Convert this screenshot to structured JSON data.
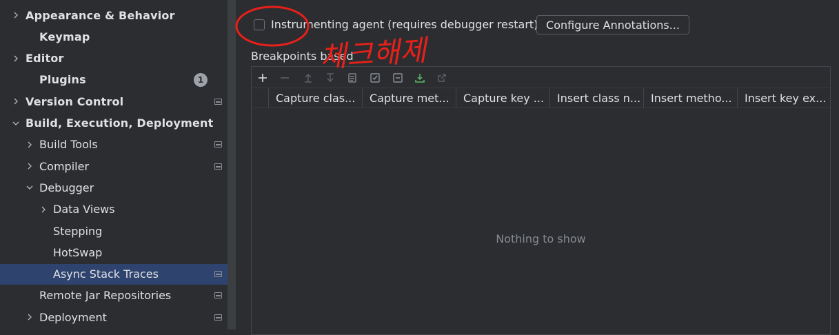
{
  "sidebar": {
    "items": [
      {
        "label": "Appearance & Behavior",
        "bold": true,
        "chevron": "right"
      },
      {
        "label": "Keymap",
        "bold": true,
        "chevron": ""
      },
      {
        "label": "Editor",
        "bold": true,
        "chevron": "right"
      },
      {
        "label": "Plugins",
        "bold": true,
        "chevron": "",
        "badge": "1"
      },
      {
        "label": "Version Control",
        "bold": true,
        "chevron": "right",
        "project_icon": true
      },
      {
        "label": "Build, Execution, Deployment",
        "bold": true,
        "chevron": "down"
      },
      {
        "label": "Build Tools",
        "chevron": "right",
        "project_icon": true
      },
      {
        "label": "Compiler",
        "chevron": "right",
        "project_icon": true
      },
      {
        "label": "Debugger",
        "chevron": "down"
      },
      {
        "label": "Data Views",
        "chevron": "right"
      },
      {
        "label": "Stepping",
        "chevron": ""
      },
      {
        "label": "HotSwap",
        "chevron": ""
      },
      {
        "label": "Async Stack Traces",
        "chevron": "",
        "selected": true,
        "project_icon": true
      },
      {
        "label": "Remote Jar Repositories",
        "chevron": "",
        "project_icon": true
      },
      {
        "label": "Deployment",
        "chevron": "right",
        "project_icon": true
      }
    ]
  },
  "main": {
    "instrumenting_checkbox": {
      "label": "Instrumenting agent (requires debugger restart)",
      "checked": false
    },
    "configure_button": "Configure Annotations...",
    "section_label": "Breakpoints based",
    "toolbar_icons": [
      "add-icon",
      "remove-icon",
      "move-up-icon",
      "move-down-icon",
      "copy-icon",
      "check-all-icon",
      "uncheck-all-icon",
      "import-icon",
      "export-icon"
    ],
    "table": {
      "columns": [
        "Capture clas...",
        "Capture met...",
        "Capture key ...",
        "Insert class n...",
        "Insert metho...",
        "Insert key ex..."
      ],
      "empty_text": "Nothing to show"
    }
  },
  "annotation": {
    "text": "체크해제",
    "color": "#e8201a"
  },
  "colors": {
    "background": "#2b2d30",
    "selection": "#2e436e",
    "text": "#dfe1e5",
    "import_icon": "#5fb865",
    "annotation": "#e8201a"
  }
}
